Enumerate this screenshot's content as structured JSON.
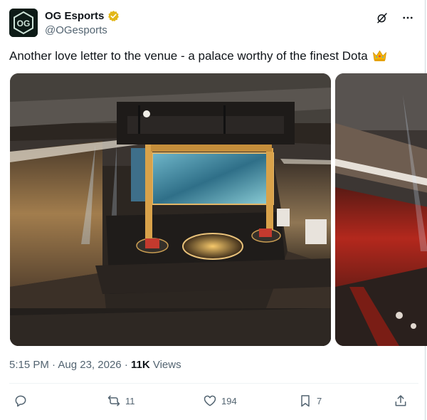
{
  "author": {
    "display_name": "OG Esports",
    "handle": "@OGesports",
    "avatar_text": "OG",
    "verified_badge_color": "#e2b719"
  },
  "header_icons": [
    "grok-icon",
    "more-icon"
  ],
  "tweet": {
    "text": "Another love letter to the venue - a palace worthy of the finest Dota",
    "emoji": "crown-emoji"
  },
  "media": [
    {
      "description": "arena-photo-main"
    },
    {
      "description": "arena-photo-secondary"
    }
  ],
  "meta": {
    "time": "5:15 PM",
    "separator": "·",
    "date": "Aug 23, 2026",
    "views_count": "11K",
    "views_label": "Views"
  },
  "actions": {
    "reply_count": "",
    "repost_count": "11",
    "like_count": "194",
    "bookmark_count": "7"
  },
  "colors": {
    "text_primary": "#0f1419",
    "text_secondary": "#536471",
    "divider": "#eff3f4"
  }
}
